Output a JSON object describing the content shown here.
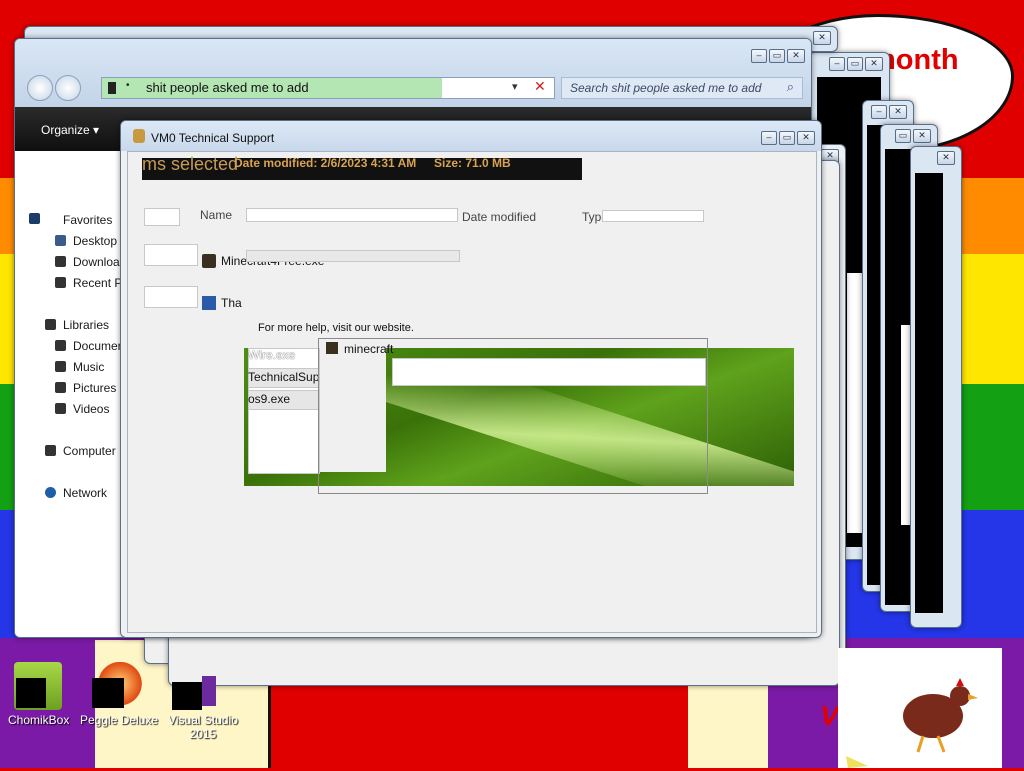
{
  "desktop": {
    "cloud_text": "month",
    "icons": [
      {
        "label": "ChomikBox"
      },
      {
        "label": "Peggle Deluxe"
      },
      {
        "label": "Visual Studio 2015"
      }
    ],
    "paint_letter": "V"
  },
  "explorer": {
    "address_text": "shit people asked me to add",
    "search_placeholder": "Search shit people asked me to add",
    "organize_label": "Organize",
    "toolbar_count": "7",
    "sidebar": {
      "favorites": "Favorites",
      "desktop": "Desktop",
      "downloads": "Downloa",
      "recent": "Recent P",
      "libraries": "Libraries",
      "documents": "Documer",
      "music": "Music",
      "pictures": "Pictures",
      "videos": "Videos",
      "computer": "Computer",
      "network": "Network"
    }
  },
  "support": {
    "title": "VM0 Technical Support",
    "ghost_selected": "ms selected",
    "ghost_modified": "Date modified: 2/6/2023 4:31 AM",
    "ghost_size": "Size: 71.0 MB",
    "col_name": "Name",
    "col_date": "Date modified",
    "col_type": "Type",
    "files": [
      "Minecraft4Free.exe",
      "Tha"
    ],
    "help_text": "For more help, visit our website.",
    "files2": [
      "Wire.exe",
      "TechnicalSupp",
      "os9.exe"
    ],
    "minecraft_item": "minecraft"
  },
  "colors": {
    "rainbow": [
      "#e00000",
      "#ff8c00",
      "#ffe600",
      "#1a9e1a",
      "#2436e8",
      "#7a1aa6"
    ]
  }
}
